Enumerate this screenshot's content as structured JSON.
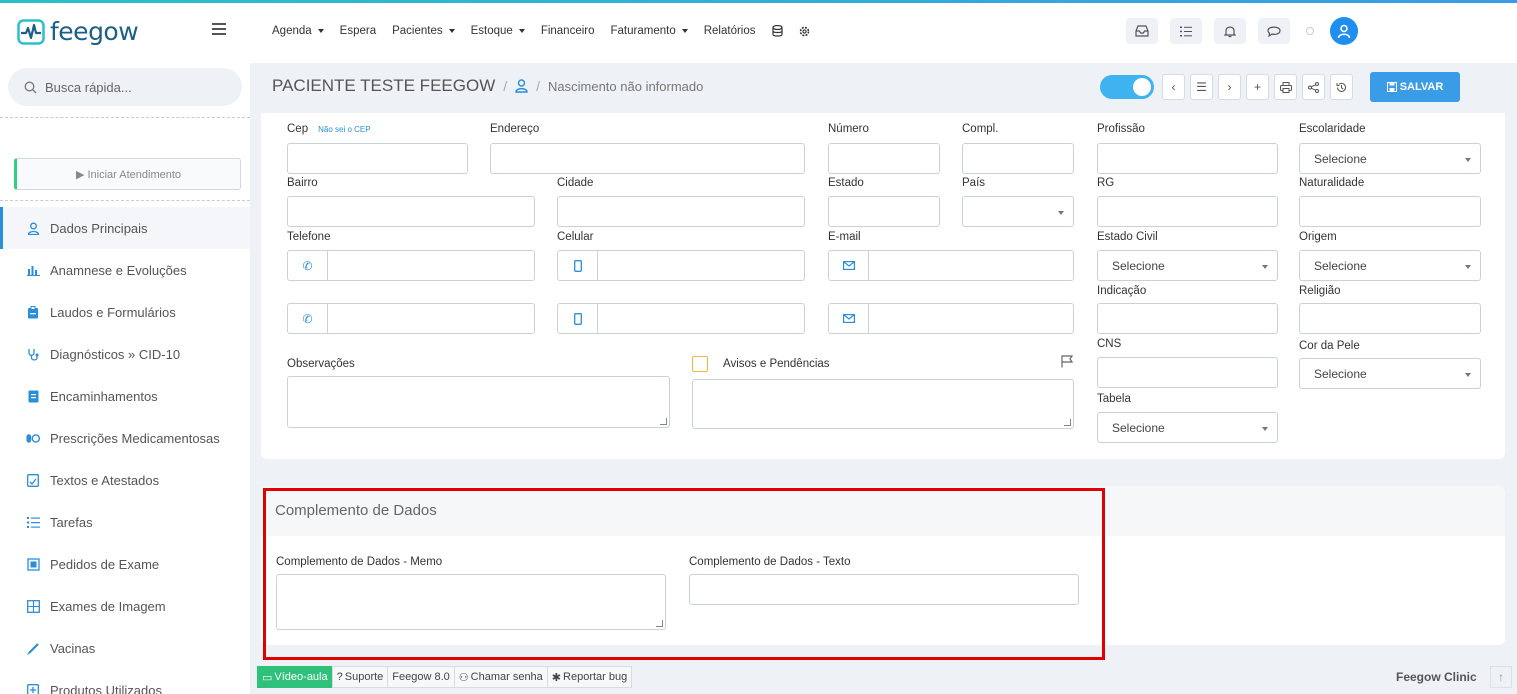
{
  "app": {
    "brand": "feegow"
  },
  "sidebar": {
    "search_placeholder": "Busca rápida...",
    "start_button": "▶ Iniciar Atendimento",
    "items": [
      {
        "label": "Dados Principais",
        "icon": "user-icon"
      },
      {
        "label": "Anamnese e Evoluções",
        "icon": "bar-chart-icon"
      },
      {
        "label": "Laudos e Formulários",
        "icon": "clipboard-icon"
      },
      {
        "label": "Diagnósticos » CID-10",
        "icon": "stethoscope-icon"
      },
      {
        "label": "Encaminhamentos",
        "icon": "document-icon"
      },
      {
        "label": "Prescrições Medicamentosas",
        "icon": "pills-icon"
      },
      {
        "label": "Textos e Atestados",
        "icon": "certificate-icon"
      },
      {
        "label": "Tarefas",
        "icon": "task-list-icon"
      },
      {
        "label": "Pedidos de Exame",
        "icon": "exam-request-icon"
      },
      {
        "label": "Exames de Imagem",
        "icon": "image-exam-icon"
      },
      {
        "label": "Vacinas",
        "icon": "syringe-icon"
      },
      {
        "label": "Produtos Utilizados",
        "icon": "product-icon"
      }
    ]
  },
  "topnav": {
    "menu": [
      {
        "label": "Agenda",
        "dropdown": true
      },
      {
        "label": "Espera",
        "dropdown": false
      },
      {
        "label": "Pacientes",
        "dropdown": true
      },
      {
        "label": "Estoque",
        "dropdown": true
      },
      {
        "label": "Financeiro",
        "dropdown": false
      },
      {
        "label": "Faturamento",
        "dropdown": true
      },
      {
        "label": "Relatórios",
        "dropdown": false
      }
    ]
  },
  "patient": {
    "name": "PACIENTE TESTE FEEGOW",
    "birth": "Nascimento não informado",
    "save_label": "SALVAR"
  },
  "form": {
    "cep": "Cep",
    "cep_help": "Não sei o CEP",
    "endereco": "Endereço",
    "numero": "Número",
    "compl": "Compl.",
    "profissao": "Profissão",
    "escolaridade": "Escolaridade",
    "bairro": "Bairro",
    "cidade": "Cidade",
    "estado": "Estado",
    "pais": "País",
    "rg": "RG",
    "naturalidade": "Naturalidade",
    "telefone": "Telefone",
    "celular": "Celular",
    "email": "E-mail",
    "estado_civil": "Estado Civil",
    "origem": "Origem",
    "indicacao": "Indicação",
    "religiao": "Religião",
    "observacoes": "Observações",
    "avisos": "Avisos e Pendências",
    "cns": "CNS",
    "cor_pele": "Cor da Pele",
    "tabela": "Tabela",
    "select_placeholder": "Selecione"
  },
  "complemento": {
    "title": "Complemento de Dados",
    "memo_label": "Complemento de Dados - Memo",
    "texto_label": "Complemento de Dados - Texto"
  },
  "footer": {
    "video": "Vídeo-aula",
    "suporte": "Suporte",
    "version": "Feegow 8.0",
    "chamar": "Chamar senha",
    "bug": "Reportar bug",
    "brand": "Feegow Clinic"
  },
  "colors": {
    "accent": "#3a9be6",
    "brand": "#1d5f86",
    "highlight": "#e00000",
    "video": "#2fc17a"
  }
}
